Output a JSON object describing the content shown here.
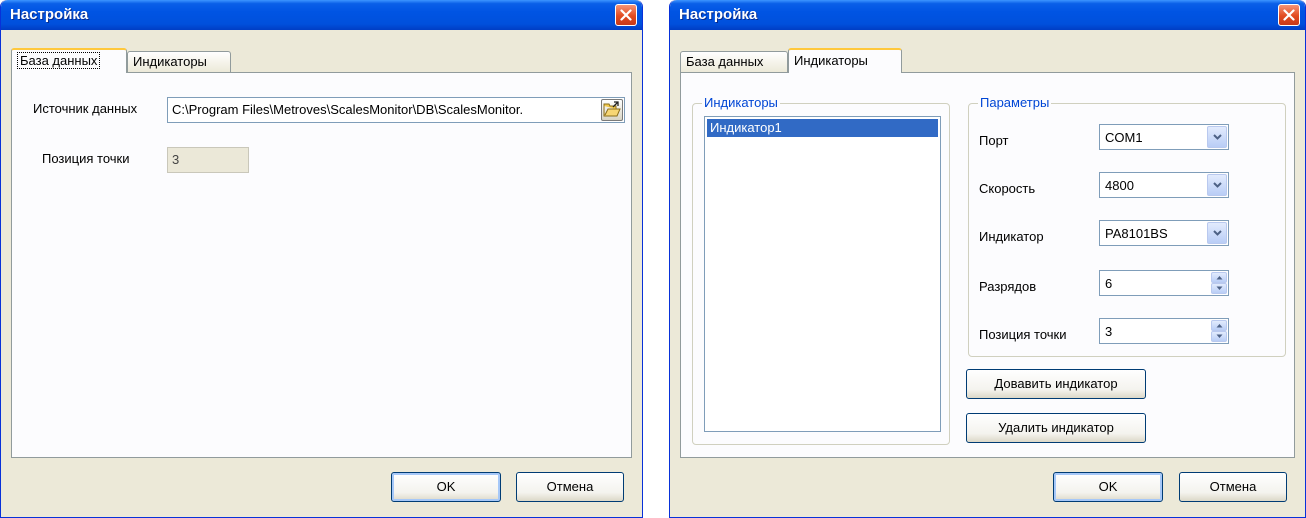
{
  "colors": {
    "titlebar": "#0054e3",
    "face": "#ece9d8",
    "selection": "#316ac5",
    "legend": "#0046d5",
    "tab_highlight": "#ffc83c"
  },
  "dialog_database": {
    "title": "Настройка",
    "tabs": [
      {
        "label": "База данных",
        "active": true
      },
      {
        "label": "Индикаторы",
        "active": false
      }
    ],
    "data_source": {
      "label": "Источник данных",
      "value": "C:\\Program Files\\Metroves\\ScalesMonitor\\DB\\ScalesMonitor.",
      "browse_icon": "folder-open-icon"
    },
    "decimal_position": {
      "label": "Позиция точки",
      "value": "3"
    },
    "ok_label": "OK",
    "cancel_label": "Отмена"
  },
  "dialog_indicators": {
    "title": "Настройка",
    "tabs": [
      {
        "label": "База данных",
        "active": false
      },
      {
        "label": "Индикаторы",
        "active": true
      }
    ],
    "indicators_group": {
      "legend": "Индикаторы",
      "items": [
        "Индикатор1"
      ],
      "selected_index": 0
    },
    "parameters_group": {
      "legend": "Параметры",
      "port": {
        "label": "Порт",
        "value": "COM1"
      },
      "speed": {
        "label": "Скорость",
        "value": "4800"
      },
      "indicator": {
        "label": "Индикатор",
        "value": "PA8101BS"
      },
      "digits": {
        "label": "Разрядов",
        "value": "6"
      },
      "decimal_position": {
        "label": "Позиция точки",
        "value": "3"
      }
    },
    "add_label": "Довавить индикатор",
    "remove_label": "Удалить индикатор",
    "ok_label": "OK",
    "cancel_label": "Отмена"
  }
}
